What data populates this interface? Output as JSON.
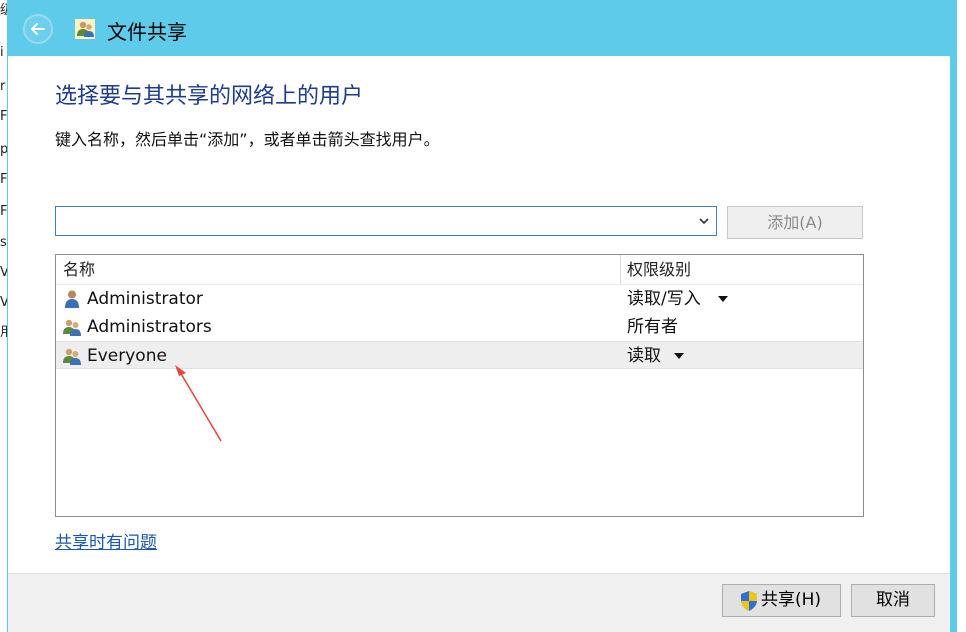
{
  "window": {
    "title": "文件共享",
    "accent_color": "#5fcbeb"
  },
  "background_chars": [
    "级",
    "i",
    "r",
    "F",
    "p",
    "F",
    "F",
    "s",
    "V",
    "V",
    "用"
  ],
  "main": {
    "heading": "选择要与其共享的网络上的用户",
    "instruction": "键入名称，然后单击“添加”，或者单击箭头查找用户。",
    "user_input": {
      "value": "",
      "placeholder": ""
    },
    "add_button": "添加(A)"
  },
  "list": {
    "columns": [
      "名称",
      "权限级别"
    ],
    "rows": [
      {
        "name": "Administrator",
        "permission": "读取/写入",
        "icon": "single-user-icon",
        "has_dropdown": true,
        "selected": false
      },
      {
        "name": "Administrators",
        "permission": "所有者",
        "icon": "user-group-icon",
        "has_dropdown": false,
        "selected": false
      },
      {
        "name": "Everyone",
        "permission": "读取",
        "icon": "user-group-icon",
        "has_dropdown": true,
        "selected": true
      }
    ]
  },
  "help_link": "共享时有问题",
  "footer": {
    "share_button": "共享(H)",
    "cancel_button": "取消"
  },
  "icons": {
    "back": "back-arrow-icon",
    "title": "user-group-icon",
    "share_shield": "uac-shield-icon"
  },
  "annotation_color": "#e8453c"
}
